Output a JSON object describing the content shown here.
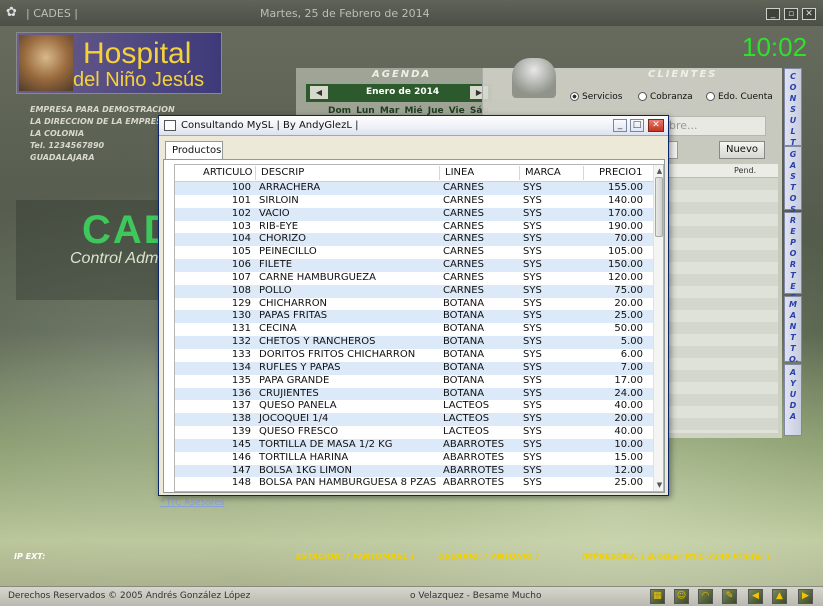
{
  "app": {
    "title": "| CADES |",
    "date": "Martes, 25 de Febrero de 2014",
    "clock": "10:02"
  },
  "logo": {
    "line1": "Hospital",
    "line2": "del Niño Jesús"
  },
  "company": {
    "lines": [
      "EMPRESA PARA DEMOSTRACION",
      "LA DIRECCION DE LA EMPRESA",
      "LA COLONIA",
      "Tel. 1234567890",
      "GUADALAJARA"
    ]
  },
  "brand": {
    "big": "CAD",
    "sub": "Control Adm"
  },
  "agenda": {
    "label": "AGENDA",
    "month": "Enero de 2014",
    "days": "Dom Lun Mar Mié Jue Vie Sáb"
  },
  "clientes": {
    "label": "CLIENTES",
    "radios": [
      "Servicios",
      "Cobranza",
      "Edo. Cuenta"
    ],
    "search_partial": "bre...",
    "new_button": "Nuevo",
    "pend_header": "Pend."
  },
  "side_tabs": [
    "CONSULTA",
    "GASTOS",
    "REPORTES",
    "MANTTO.",
    "AYUDA"
  ],
  "dialog": {
    "title": "Consultando MySL  |  By  AndyGlezL  |",
    "tab": "Productos",
    "columns": [
      "ARTICULO",
      "DESCRIP",
      "LINEA",
      "MARCA",
      "PRECIO1"
    ],
    "rows": [
      [
        "100",
        "ARRACHERA",
        "CARNES",
        "SYS",
        "155.00"
      ],
      [
        "101",
        "SIRLOIN",
        "CARNES",
        "SYS",
        "140.00"
      ],
      [
        "102",
        "VACIO",
        "CARNES",
        "SYS",
        "170.00"
      ],
      [
        "103",
        "RIB-EYE",
        "CARNES",
        "SYS",
        "190.00"
      ],
      [
        "104",
        "CHORIZO",
        "CARNES",
        "SYS",
        "70.00"
      ],
      [
        "105",
        "PEINECILLO",
        "CARNES",
        "SYS",
        "105.00"
      ],
      [
        "106",
        "FILETE",
        "CARNES",
        "SYS",
        "150.00"
      ],
      [
        "107",
        "CARNE HAMBURGUEZA",
        "CARNES",
        "SYS",
        "120.00"
      ],
      [
        "108",
        "POLLO",
        "CARNES",
        "SYS",
        "75.00"
      ],
      [
        "129",
        "CHICHARRON",
        "BOTANA",
        "SYS",
        "20.00"
      ],
      [
        "130",
        "PAPAS FRITAS",
        "BOTANA",
        "SYS",
        "25.00"
      ],
      [
        "131",
        "CECINA",
        "BOTANA",
        "SYS",
        "50.00"
      ],
      [
        "132",
        "CHETOS Y RANCHEROS",
        "BOTANA",
        "SYS",
        "5.00"
      ],
      [
        "133",
        "DORITOS FRITOS CHICHARRON",
        "BOTANA",
        "SYS",
        "6.00"
      ],
      [
        "134",
        "RUFLES Y PAPAS",
        "BOTANA",
        "SYS",
        "7.00"
      ],
      [
        "135",
        "PAPA GRANDE",
        "BOTANA",
        "SYS",
        "17.00"
      ],
      [
        "136",
        "CRUJIENTES",
        "BOTANA",
        "SYS",
        "24.00"
      ],
      [
        "137",
        "QUESO PANELA",
        "LACTEOS",
        "SYS",
        "40.00"
      ],
      [
        "138",
        "JOCOQUEI 1/4",
        "LACTEOS",
        "SYS",
        "20.00"
      ],
      [
        "139",
        "QUESO FRESCO",
        "LACTEOS",
        "SYS",
        "40.00"
      ],
      [
        "145",
        "TORTILLA DE MASA 1/2 KG",
        "ABARROTES",
        "SYS",
        "10.00"
      ],
      [
        "146",
        "TORTILLA HARINA",
        "ABARROTES",
        "SYS",
        "15.00"
      ],
      [
        "147",
        "BOLSA 1KG LIMON",
        "ABARROTES",
        "SYS",
        "12.00"
      ],
      [
        "148",
        "BOLSA PAN HAMBURGUESA 8 PZAS",
        "ABARROTES",
        "SYS",
        "25.00"
      ]
    ]
  },
  "link": "* ITC Asesores",
  "status": {
    "ip": "IP EXT:",
    "estacion": "ESTACION:  [  FANTOMAS1  ]",
    "usuario": "USUARIO:  [  ANTONIO  ]",
    "impresora": "IMPRESORA:  [  Brother MFC-7340 Printer  ]"
  },
  "footer": {
    "copyright": "Derechos Reservados © 2005 Andrés González López",
    "song": "o Velazquez - Besame Mucho"
  },
  "colors": {
    "clock": "#2fe02f",
    "logo_text": "#f5d23a",
    "status_text": "#f0d000",
    "row_alt": "#dce9f8",
    "side_tab_text": "#2c3fa8"
  }
}
